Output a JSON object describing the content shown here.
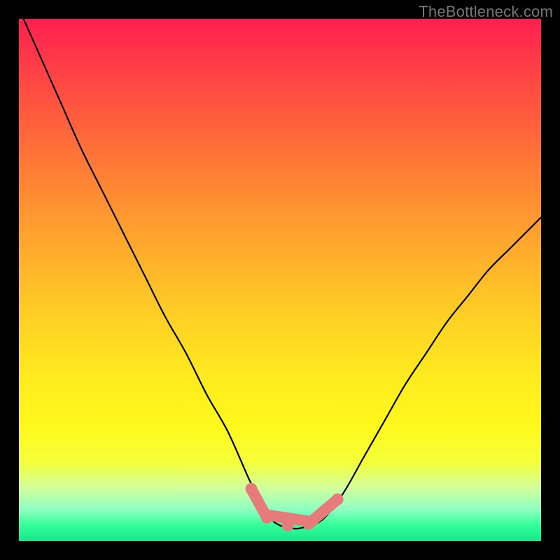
{
  "watermark": "TheBottleneck.com",
  "chart_data": {
    "type": "line",
    "title": "",
    "xlabel": "",
    "ylabel": "",
    "xlim": [
      0,
      100
    ],
    "ylim": [
      0,
      100
    ],
    "series": [
      {
        "name": "bottleneck-curve",
        "x": [
          0,
          4,
          8,
          12,
          16,
          20,
          24,
          28,
          32,
          36,
          40,
          44,
          46,
          48,
          50,
          52,
          54,
          58,
          62,
          66,
          70,
          74,
          78,
          82,
          86,
          90,
          94,
          98,
          100
        ],
        "values": [
          102,
          93,
          84,
          75,
          67,
          59,
          51,
          43,
          36,
          28,
          21,
          12,
          8,
          4.5,
          3,
          2.5,
          2.5,
          4,
          9,
          16,
          23,
          30,
          36,
          42,
          47,
          52,
          56,
          60,
          62
        ]
      }
    ],
    "markers": [
      {
        "name": "marker-left",
        "x": 44.5,
        "y": 10
      },
      {
        "name": "marker-mid-a",
        "x": 47.5,
        "y": 4.5
      },
      {
        "name": "marker-mid-b",
        "x": 51.5,
        "y": 3
      },
      {
        "name": "marker-mid-c",
        "x": 55.5,
        "y": 3.3
      },
      {
        "name": "marker-right",
        "x": 61,
        "y": 8
      }
    ],
    "colors": {
      "curve": "#000000",
      "marker_fill": "#e77a7a",
      "gradient_top": "#ff1f4f",
      "gradient_bottom": "#16e58a"
    }
  }
}
